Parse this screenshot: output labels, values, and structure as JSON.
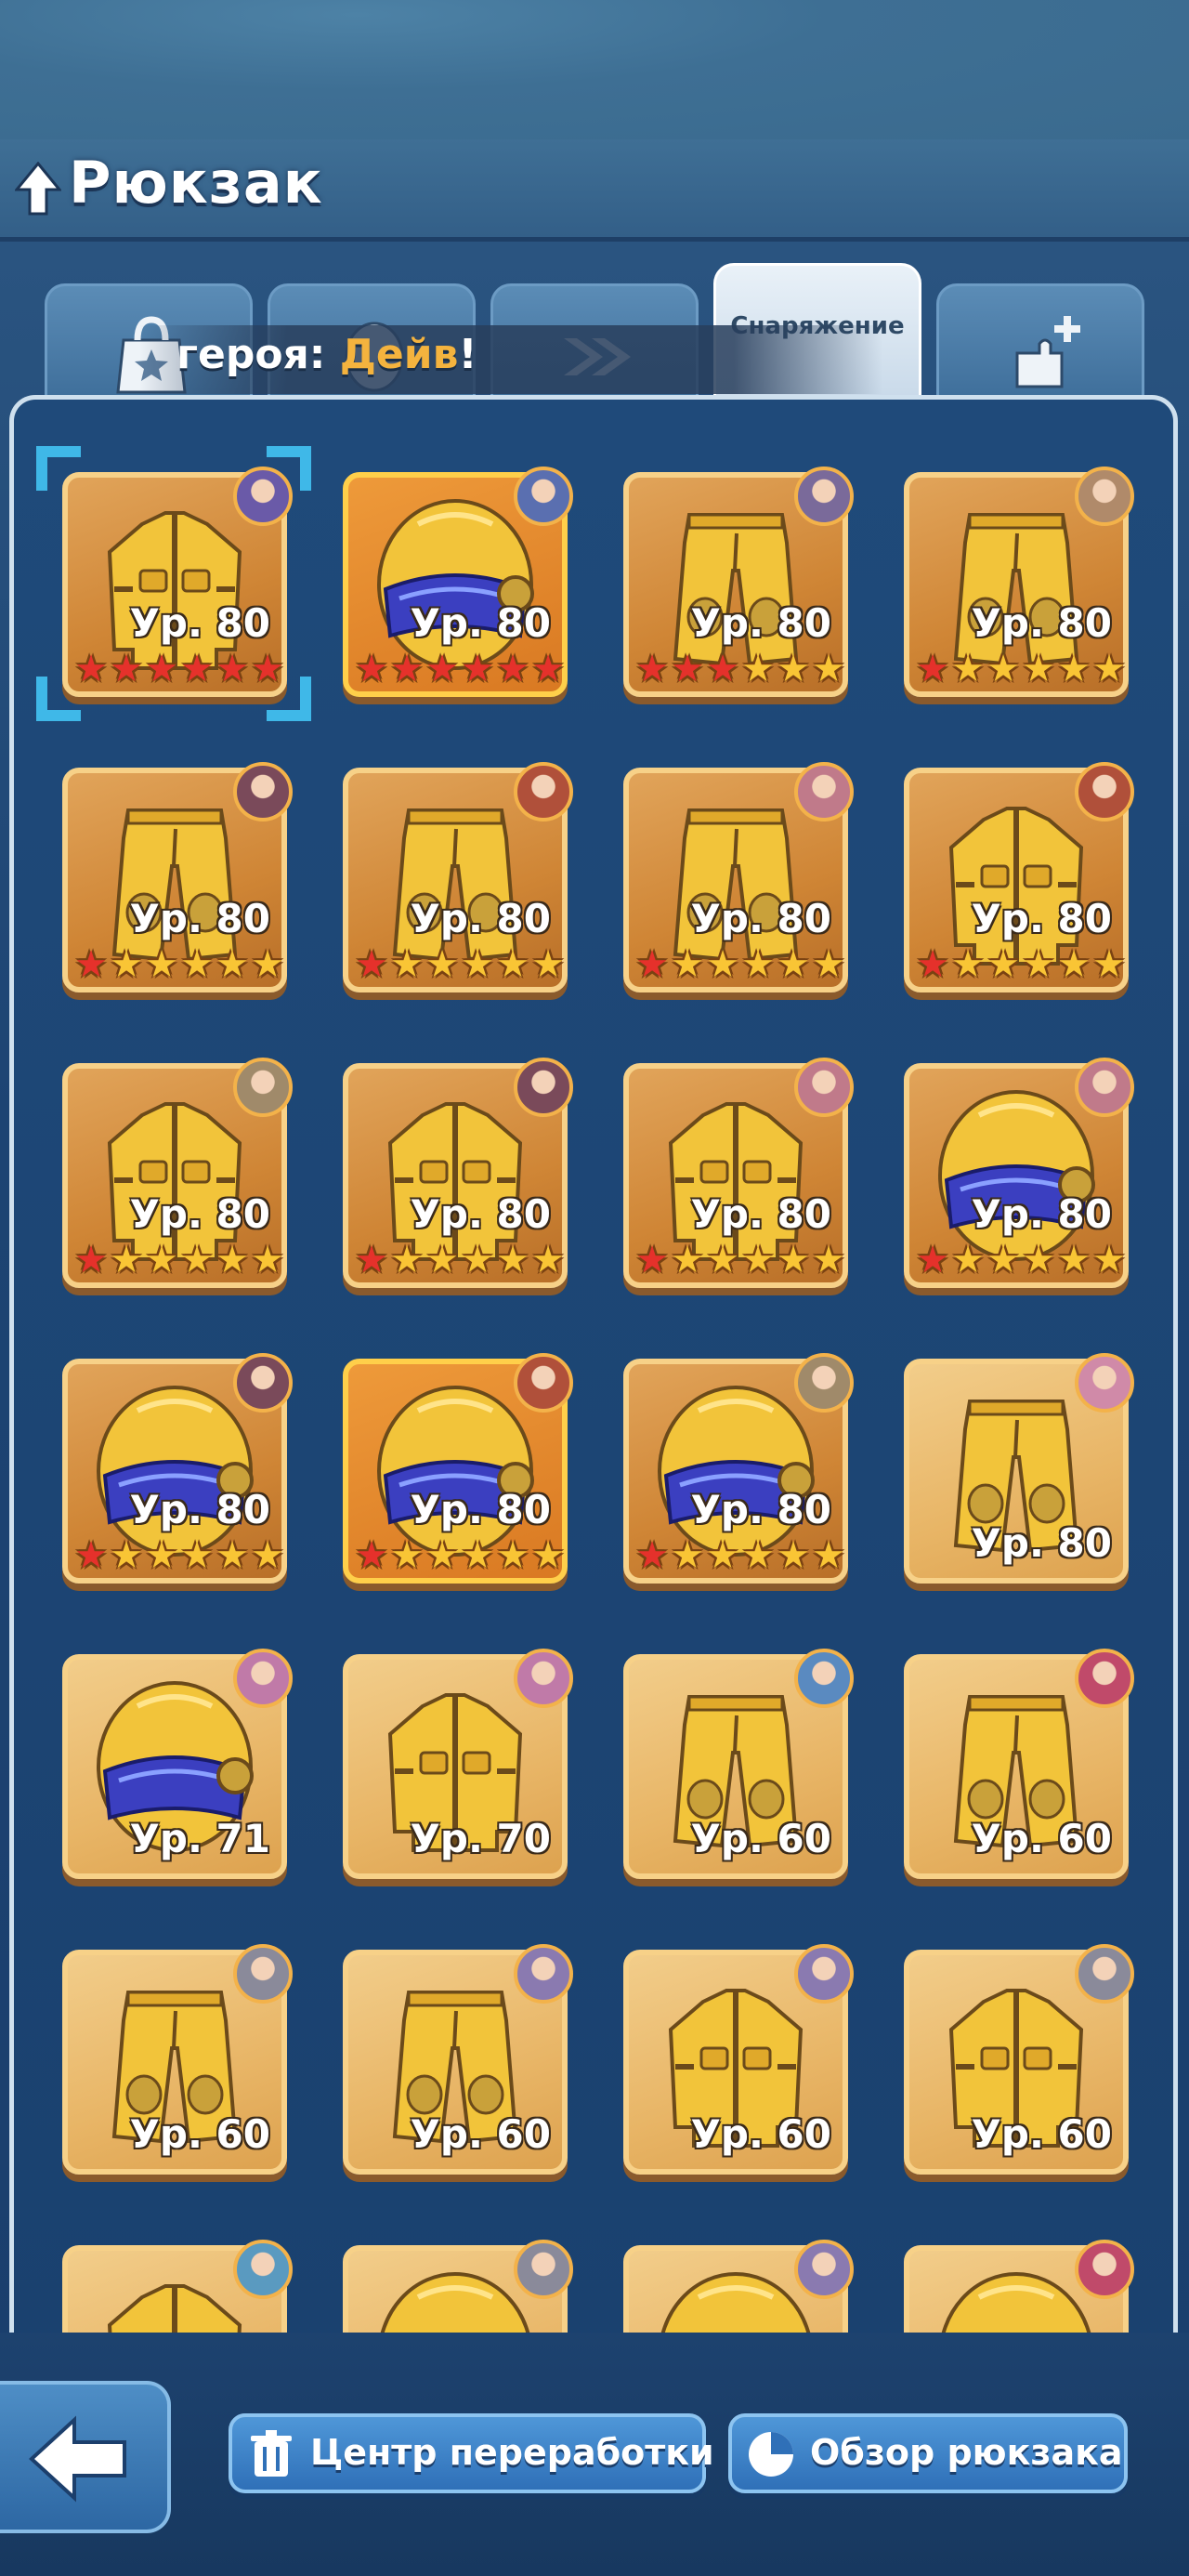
{
  "header": {
    "title": "Рюкзак",
    "back_icon": "arrow-up-icon"
  },
  "tabs": [
    {
      "id": "tab-1",
      "icon": "shopping-bag-star-icon",
      "label": ""
    },
    {
      "id": "tab-2",
      "icon": "egg-icon",
      "label": ""
    },
    {
      "id": "tab-3",
      "icon": "double-chevron-icon",
      "label": ""
    },
    {
      "id": "tab-4",
      "icon": "",
      "label": "Снаряжение",
      "active": true
    },
    {
      "id": "tab-5",
      "icon": "puzzle-plus-icon",
      "label": ""
    }
  ],
  "banner": {
    "prefix": "героя: ",
    "hero_name": "Дейв",
    "suffix": "!"
  },
  "items": [
    {
      "type": "jacket",
      "level": "Ур. 80",
      "red": 6,
      "stars": 6,
      "frame": "dark",
      "selected": true
    },
    {
      "type": "helmet",
      "level": "Ур. 80",
      "red": 6,
      "stars": 6,
      "frame": "gold"
    },
    {
      "type": "pants",
      "level": "Ур. 80",
      "red": 3,
      "stars": 6,
      "frame": "dark"
    },
    {
      "type": "pants",
      "level": "Ур. 80",
      "red": 1,
      "stars": 6,
      "frame": "dark"
    },
    {
      "type": "pants",
      "level": "Ур. 80",
      "red": 1,
      "stars": 6,
      "frame": "dark"
    },
    {
      "type": "pants",
      "level": "Ур. 80",
      "red": 1,
      "stars": 6,
      "frame": "dark"
    },
    {
      "type": "pants",
      "level": "Ур. 80",
      "red": 1,
      "stars": 6,
      "frame": "dark"
    },
    {
      "type": "jacket",
      "level": "Ур. 80",
      "red": 1,
      "stars": 6,
      "frame": "dark"
    },
    {
      "type": "jacket",
      "level": "Ур. 80",
      "red": 1,
      "stars": 6,
      "frame": "dark"
    },
    {
      "type": "jacket",
      "level": "Ур. 80",
      "red": 1,
      "stars": 6,
      "frame": "dark"
    },
    {
      "type": "jacket",
      "level": "Ур. 80",
      "red": 1,
      "stars": 6,
      "frame": "dark"
    },
    {
      "type": "helmet",
      "level": "Ур. 80",
      "red": 1,
      "stars": 6,
      "frame": "dark"
    },
    {
      "type": "helmet",
      "level": "Ур. 80",
      "red": 1,
      "stars": 6,
      "frame": "dark"
    },
    {
      "type": "helmet",
      "level": "Ур. 80",
      "red": 1,
      "stars": 6,
      "frame": "gold"
    },
    {
      "type": "helmet",
      "level": "Ур. 80",
      "red": 1,
      "stars": 6,
      "frame": "dark"
    },
    {
      "type": "pants",
      "level": "Ур. 80",
      "red": 0,
      "stars": 0,
      "frame": "light"
    },
    {
      "type": "helmet",
      "level": "Ур. 71",
      "red": 0,
      "stars": 0,
      "frame": "light"
    },
    {
      "type": "jacket",
      "level": "Ур. 70",
      "red": 0,
      "stars": 0,
      "frame": "light"
    },
    {
      "type": "pants",
      "level": "Ур. 60",
      "red": 0,
      "stars": 0,
      "frame": "light"
    },
    {
      "type": "pants",
      "level": "Ур. 60",
      "red": 0,
      "stars": 0,
      "frame": "light"
    },
    {
      "type": "pants",
      "level": "Ур. 60",
      "red": 0,
      "stars": 0,
      "frame": "light"
    },
    {
      "type": "pants",
      "level": "Ур. 60",
      "red": 0,
      "stars": 0,
      "frame": "light"
    },
    {
      "type": "jacket",
      "level": "Ур. 60",
      "red": 0,
      "stars": 0,
      "frame": "light"
    },
    {
      "type": "jacket",
      "level": "Ур. 60",
      "red": 0,
      "stars": 0,
      "frame": "light"
    },
    {
      "type": "jacket",
      "level": "",
      "red": 0,
      "stars": 0,
      "frame": "light"
    },
    {
      "type": "helmet",
      "level": "",
      "red": 0,
      "stars": 0,
      "frame": "light"
    },
    {
      "type": "helmet",
      "level": "",
      "red": 0,
      "stars": 0,
      "frame": "light"
    },
    {
      "type": "helmet",
      "level": "",
      "red": 0,
      "stars": 0,
      "frame": "light"
    }
  ],
  "avatar_colors": [
    "#6a5aa8",
    "#5a6fb0",
    "#7a6a9a",
    "#b08a6a",
    "#7a4a5a",
    "#b0503a",
    "#c07a8a",
    "#b0503a",
    "#a08a6a",
    "#7a4a5a",
    "#c07a8a",
    "#c07a8a",
    "#7a4a5a",
    "#b0503a",
    "#a08a6a",
    "#d08aa8",
    "#c07aa8",
    "#c07aa8",
    "#5a8ac0",
    "#c04a6a",
    "#8a8a9a",
    "#8a7ab0",
    "#8a7ab0",
    "#8a8a9a",
    "#5a9ac0",
    "#8a8a9a",
    "#8a7ab0",
    "#c04a6a"
  ],
  "footer": {
    "back_icon": "arrow-left-icon",
    "recycle_label": "Центр переработки",
    "overview_label": "Обзор рюкзака"
  },
  "colors": {
    "red_star": "#e5312b",
    "gold_star": "#f9c535",
    "hero_name": "#f4b33e"
  }
}
